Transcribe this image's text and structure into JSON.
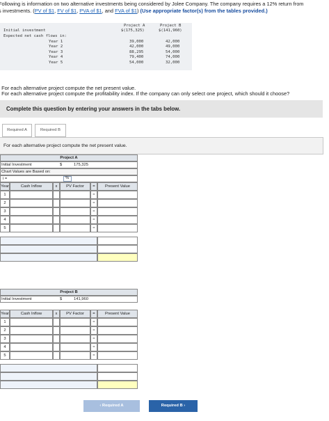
{
  "intro": {
    "line1": "Following is information on two alternative investments being considered by Jolee Company. The company requires a 12% return from",
    "line2_prefix": "s investments. (",
    "links": [
      "PV of $1",
      "FV of $1",
      "PVA of $1",
      "FVA of $1"
    ],
    "line2_suffix": "(Use appropriate factor(s) from the tables provided.)"
  },
  "data_table": {
    "col_a": "Project A",
    "col_b": "Project B",
    "initial_label": "Initial investment",
    "initial_a": "$(175,325)",
    "initial_b": "$(141,960)",
    "flows_label": "Expected net cash flows in:",
    "rows": [
      {
        "label": "Year 1",
        "a": "39,000",
        "b": "42,000"
      },
      {
        "label": "Year 2",
        "a": "42,000",
        "b": "49,000"
      },
      {
        "label": "Year 3",
        "a": "88,295",
        "b": "54,000"
      },
      {
        "label": "Year 4",
        "a": "79,400",
        "b": "74,000"
      },
      {
        "label": "Year 5",
        "a": "54,000",
        "b": "32,000"
      }
    ]
  },
  "questions": {
    "a": "For each alternative project compute the net present value.",
    "b": "For each alternative project compute the profitability index. If the company can only select one project, which should it choose?"
  },
  "banner": "Complete this question by entering your answers in the tabs below.",
  "tabs": [
    "Required A",
    "Required B"
  ],
  "panel_text": "For each alternative project compute the net present value.",
  "project_a": {
    "title": "Project A",
    "initial_label": "Initial Investment",
    "dollar": "$",
    "initial_value": "175,325",
    "chart_values_label": "Chart Values are Based on:",
    "i_label": "i =",
    "pct": "%",
    "headers": {
      "year": "Year",
      "cash": "Cash Inflow",
      "x": "x",
      "factor": "PV Factor",
      "eq": "=",
      "pv": "Present Value"
    },
    "years": [
      "1",
      "2",
      "3",
      "4",
      "5"
    ],
    "eq": "="
  },
  "project_b": {
    "title": "Project B",
    "initial_label": "Initial Investment",
    "dollar": "$",
    "initial_value": "141,960",
    "headers": {
      "year": "Year",
      "cash": "Cash Inflow",
      "x": "x",
      "factor": "PV Factor",
      "eq": "=",
      "pv": "Present Value"
    },
    "years": [
      "1",
      "2",
      "3",
      "4",
      "5"
    ],
    "eq": "="
  },
  "nav": {
    "prev": "‹  Required A",
    "next": "Required B  ›"
  }
}
